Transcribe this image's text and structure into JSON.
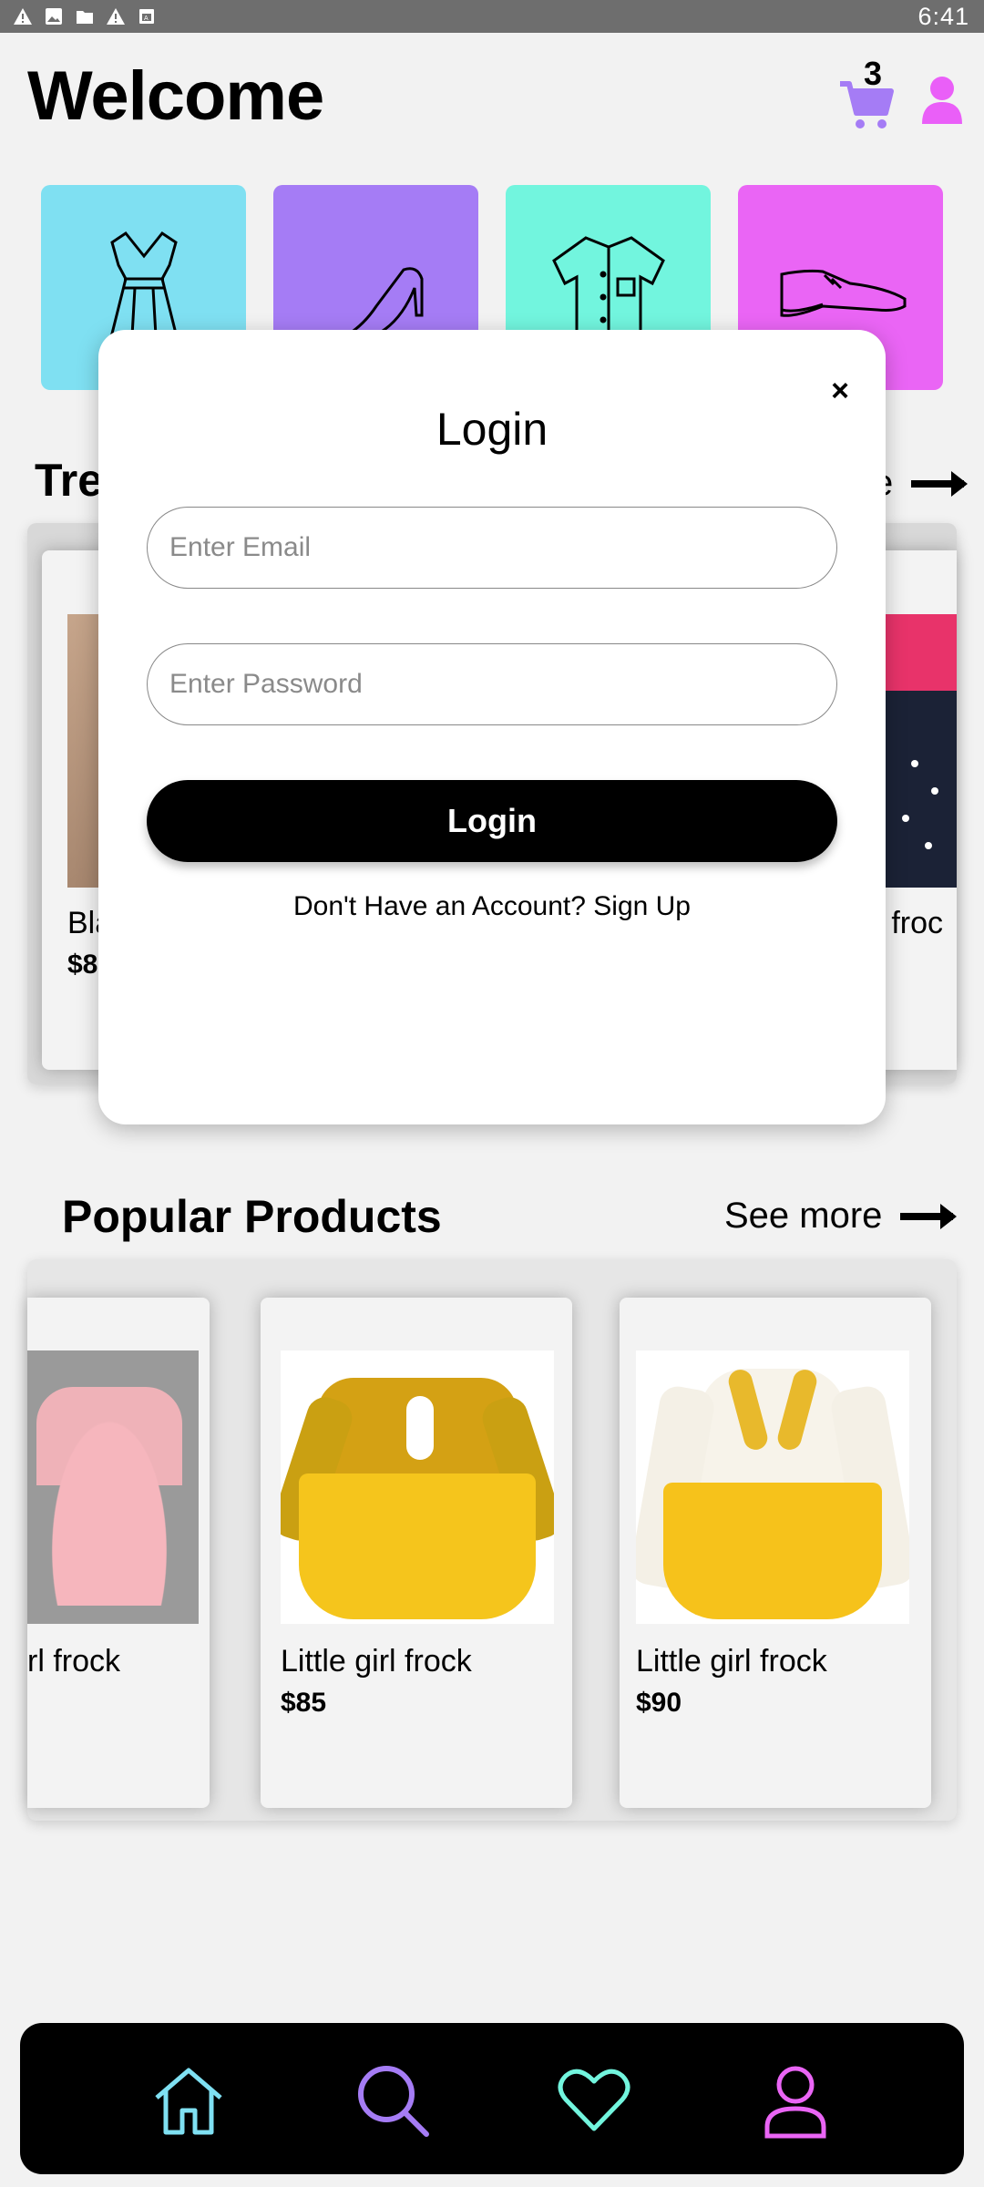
{
  "status_bar": {
    "time": "6:41",
    "icons": [
      "warning-icon",
      "image-icon",
      "folder-icon",
      "warning-icon",
      "calendar-icon"
    ]
  },
  "header": {
    "title": "Welcome",
    "cart_count": "3",
    "cart_color": "#a57cf5",
    "user_color": "#ea5ff8"
  },
  "categories": [
    {
      "name": "dress",
      "icon": "dress-icon",
      "color": "#7fe0f2"
    },
    {
      "name": "heels",
      "icon": "high-heel-icon",
      "color": "#a57cf5"
    },
    {
      "name": "shirt",
      "icon": "shirt-icon",
      "color": "#72f5de"
    },
    {
      "name": "shoes",
      "icon": "dress-shoe-icon",
      "color": "#ea65f5"
    }
  ],
  "trending": {
    "title_partial": "Tre",
    "see_more_partial": "e",
    "left_card": {
      "name_partial": "Bla",
      "price_partial": "$8"
    },
    "right_card": {
      "name_partial": "rl froc"
    }
  },
  "popular": {
    "title": "Popular Products",
    "see_more": "See more",
    "products": [
      {
        "name": "rl frock",
        "price": ""
      },
      {
        "name": "Little girl frock",
        "price": "$85"
      },
      {
        "name": "Little girl frock",
        "price": "$90"
      }
    ]
  },
  "login_modal": {
    "close": "×",
    "title": "Login",
    "email_placeholder": "Enter Email",
    "password_placeholder": "Enter Password",
    "button_label": "Login",
    "signup_text": "Don't Have an Account? Sign Up"
  },
  "bottom_nav": {
    "items": [
      {
        "icon": "home-icon",
        "color": "#7fe0f2"
      },
      {
        "icon": "search-icon",
        "color": "#a57cf5"
      },
      {
        "icon": "heart-icon",
        "color": "#72f5de"
      },
      {
        "icon": "profile-icon",
        "color": "#ea65f5"
      }
    ]
  }
}
